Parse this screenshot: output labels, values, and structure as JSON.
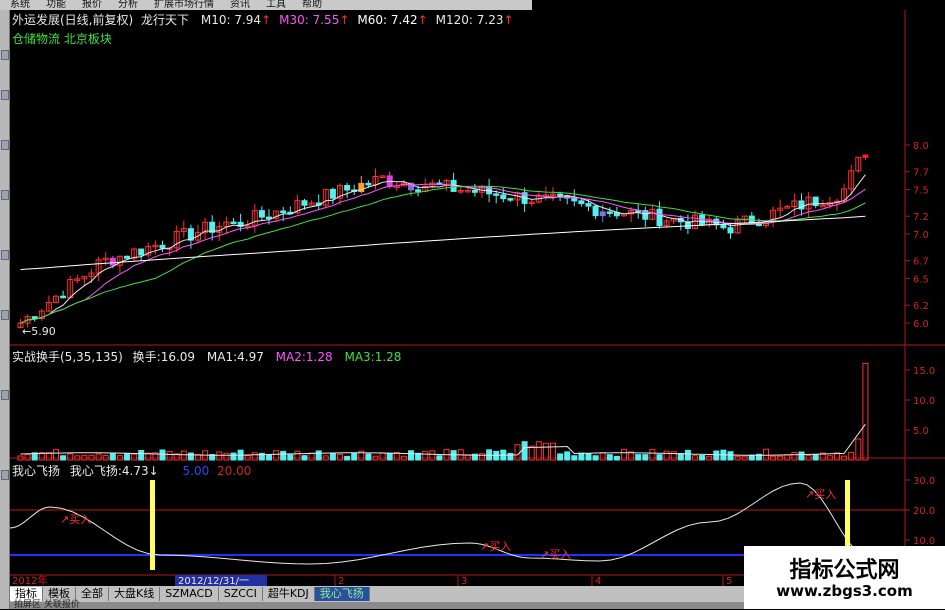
{
  "menu": [
    "系统",
    "功能",
    "报价",
    "分析",
    "扩展市场行情",
    "资讯",
    "工具",
    "帮助"
  ],
  "price_panel": {
    "stock": "外运发展(日线,前复权)",
    "indicator": "龙行天下",
    "ma": [
      {
        "label": "M10:",
        "value": "7.94",
        "color": "#e8e8e8"
      },
      {
        "label": "M30:",
        "value": "7.55",
        "color": "#ff55ff"
      },
      {
        "label": "M60:",
        "value": "7.42",
        "color": "#ffffff"
      },
      {
        "label": "M120:",
        "value": "7.23",
        "color": "#e8e8e8"
      }
    ],
    "sector1": "仓储物流",
    "sector2": "北京板块",
    "low_label": "5.90",
    "y_ticks": [
      "8.0",
      "7.7",
      "7.5",
      "7.2",
      "7.0",
      "6.7",
      "6.5",
      "6.2",
      "6.0"
    ]
  },
  "vol_panel": {
    "name": "实战换手(5,35,135)",
    "k1": "换手:",
    "v1": "16.09",
    "k2": "MA1:",
    "v2": "4.97",
    "k3": "MA2:",
    "v3": "1.28",
    "k4": "MA3:",
    "v4": "1.28",
    "y_ticks": [
      "15.0",
      "10.0",
      "5.0"
    ]
  },
  "osc_panel": {
    "name": "我心飞扬",
    "k1": "我心飞扬:",
    "v1": "4.73",
    "lo": "5.00",
    "hi": "20.00",
    "y_ticks": [
      "30.0",
      "20.0",
      "10.0"
    ],
    "buy_label": "买入"
  },
  "axis": {
    "year": "2012年",
    "cursor": "2012/12/31/一",
    "months": [
      "2",
      "3",
      "4",
      "5"
    ]
  },
  "tabs": [
    "指标",
    "模板",
    "全部",
    "大盘K线",
    "SZMACD",
    "SZCCI",
    "超牛KDJ",
    "我心飞扬"
  ],
  "bottom_text": "拍屏区 关联报价",
  "watermark": {
    "title": "指标公式网",
    "url": "www.zbgs3.com"
  }
}
